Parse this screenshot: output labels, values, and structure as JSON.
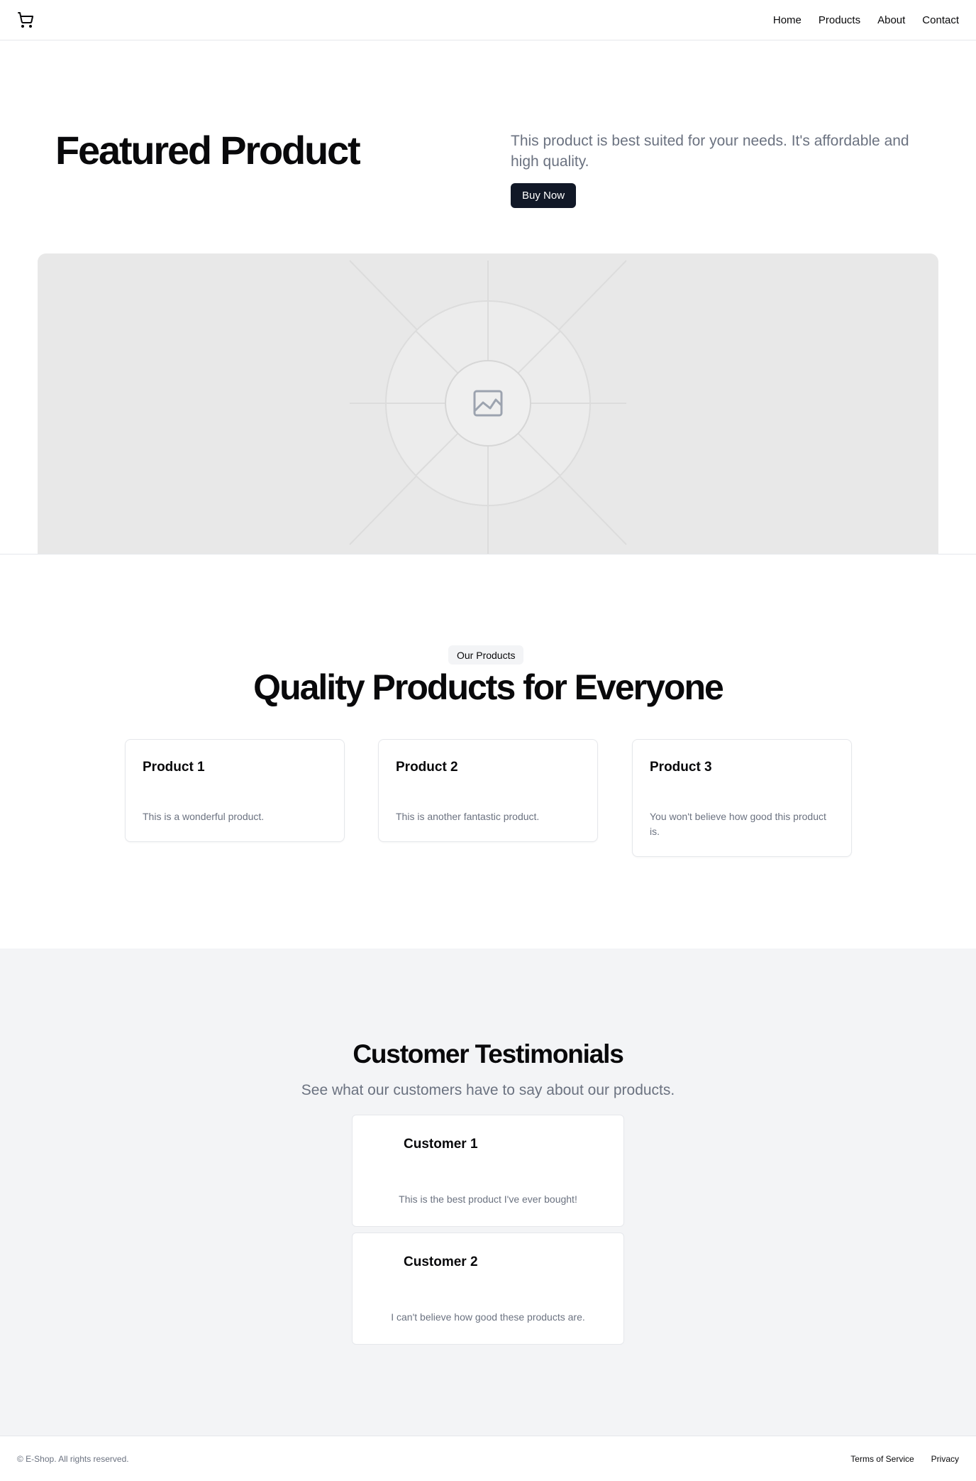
{
  "header": {
    "logo_icon": "shopping-cart-icon",
    "nav": [
      {
        "label": "Home"
      },
      {
        "label": "Products"
      },
      {
        "label": "About"
      },
      {
        "label": "Contact"
      }
    ]
  },
  "hero": {
    "title": "Featured Product",
    "description": "This product is best suited for your needs. It's affordable and high quality.",
    "button_label": "Buy Now",
    "image_icon": "image-placeholder-icon"
  },
  "products": {
    "badge": "Our Products",
    "title": "Quality Products for Everyone",
    "items": [
      {
        "name": "Product 1",
        "description": "This is a wonderful product."
      },
      {
        "name": "Product 2",
        "description": "This is another fantastic product."
      },
      {
        "name": "Product 3",
        "description": "You won't believe how good this product is."
      }
    ]
  },
  "testimonials": {
    "title": "Customer Testimonials",
    "subtitle": "See what our customers have to say about our products.",
    "items": [
      {
        "name": "Customer 1",
        "quote": "This is the best product I've ever bought!"
      },
      {
        "name": "Customer 2",
        "quote": "I can't believe how good these products are."
      }
    ]
  },
  "footer": {
    "copyright": "© E-Shop. All rights reserved.",
    "links": [
      {
        "label": "Terms of Service"
      },
      {
        "label": "Privacy"
      }
    ]
  },
  "colors": {
    "primary": "#111827",
    "muted_text": "#6b7280",
    "border": "#e5e7eb",
    "section_bg": "#f3f4f6"
  }
}
